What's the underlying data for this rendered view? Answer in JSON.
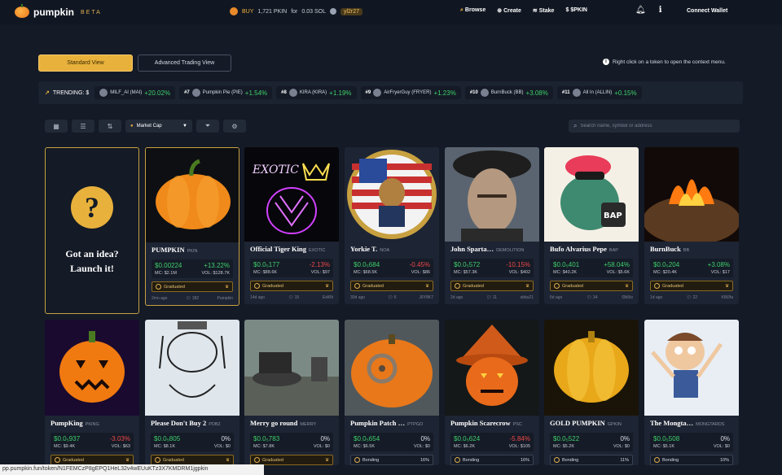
{
  "brand": {
    "name": "pumpkin",
    "tag": "BETA"
  },
  "ticker": {
    "action": "BUY",
    "amount": "1,721 PKIN",
    "for_label": "for",
    "sol": "0.03 SOL",
    "user": "yl2r27"
  },
  "nav": [
    {
      "icon": "search-icon",
      "glyph": "⌕",
      "label": "Browse"
    },
    {
      "icon": "plus-circle-icon",
      "glyph": "⊕",
      "label": "Create"
    },
    {
      "icon": "stack-icon",
      "glyph": "≋",
      "label": "Stake"
    },
    {
      "icon": "dollar-icon",
      "glyph": "$",
      "label": "$PKIN"
    }
  ],
  "connect_label": "Connect Wallet",
  "views": {
    "standard": "Standard View",
    "advanced": "Advanced Trading View"
  },
  "hint": "Right click on a token to open the context menu.",
  "trending": {
    "label": "TRENDING:",
    "prefix": "$",
    "items": [
      {
        "rank": "",
        "name": "MILF_AI (MAI)",
        "pct": "+20.02%"
      },
      {
        "rank": "#7",
        "name": "Pumpkin Pie (PIE)",
        "pct": "+1.54%"
      },
      {
        "rank": "#8",
        "name": "KIRA (KIRA)",
        "pct": "+1.19%"
      },
      {
        "rank": "#9",
        "name": "AirFryerGuy (FRYER)",
        "pct": "+1.23%"
      },
      {
        "rank": "#10",
        "name": "BurnBuck (BB)",
        "pct": "+3.08%"
      },
      {
        "rank": "#11",
        "name": "All In (ALLIN)",
        "pct": "+0.15%"
      }
    ]
  },
  "toolbar": {
    "sort": "Market Cap",
    "search_placeholder": "Search name, symbol or address"
  },
  "idea": {
    "line1": "Got an idea?",
    "line2": "Launch it!",
    "glyph": "?"
  },
  "cards_row1": [
    {
      "name": "PUMPKIN",
      "sym": "PKIN",
      "price": "$0.00224",
      "pct": "+13.22%",
      "dir": "up",
      "mc": "MC: $2.1M",
      "vol": "VOL: $128.7K",
      "badge": "Graduated",
      "type": "grad",
      "age": "2mo ago",
      "replies": "182",
      "creator": "Pumpkin"
    },
    {
      "name": "Official Tiger King",
      "sym": "EXOTIC",
      "price": "$0.0₅177",
      "pct": "-2.13%",
      "dir": "dn",
      "mc": "MC: $88.6K",
      "vol": "VOL: $97",
      "badge": "Graduated",
      "type": "grad",
      "age": "14d ago",
      "replies": "15",
      "creator": "Ed45t"
    },
    {
      "name": "Yorkie T.",
      "sym": "NOA",
      "price": "$0.0₅684",
      "pct": "-0.45%",
      "dir": "dn",
      "mc": "MC: $68.5K",
      "vol": "VOL: $86",
      "badge": "Graduated",
      "type": "grad",
      "age": "30d ago",
      "replies": "6",
      "creator": "J6Y8K7"
    },
    {
      "name": "John Sparta…",
      "sym": "DEMOLITION",
      "price": "$0.0₅572",
      "pct": "-10.15%",
      "dir": "dn",
      "mc": "MC: $57.3K",
      "vol": "VOL: $402",
      "badge": "Graduated",
      "type": "grad",
      "age": "2d ago",
      "replies": "11",
      "creator": "sbbu21"
    },
    {
      "name": "Bufo Alvarius Pepe",
      "sym": "BAP",
      "price": "$0.0₅401",
      "pct": "+58.04%",
      "dir": "up",
      "mc": "MC: $40.2K",
      "vol": "VOL: $5.6K",
      "badge": "Graduated",
      "type": "grad",
      "age": "5d ago",
      "replies": "34",
      "creator": "f3b5tv"
    },
    {
      "name": "BurnBuck",
      "sym": "BB",
      "price": "$0.0₅204",
      "pct": "+3.08%",
      "dir": "up",
      "mc": "MC: $20.4K",
      "vol": "VOL: $17",
      "badge": "Graduated",
      "type": "grad",
      "age": "1d ago",
      "replies": "22",
      "creator": "K8t2fa"
    }
  ],
  "cards_row2": [
    {
      "name": "PumpKing",
      "sym": "PKING",
      "price": "$0.0₅937",
      "pct": "-3.03%",
      "dir": "dn",
      "mc": "MC: $9.4K",
      "vol": "VOL: $63",
      "badge": "Graduated",
      "type": "grad"
    },
    {
      "name": "Please Don't Buy 2",
      "sym": "PDB2",
      "price": "$0.0₅805",
      "pct": "0%",
      "dir": "flat",
      "mc": "MC: $8.1K",
      "vol": "VOL: $0",
      "badge": "Graduated",
      "type": "grad"
    },
    {
      "name": "Merry go round",
      "sym": "MERRY",
      "price": "$0.0₅783",
      "pct": "0%",
      "dir": "flat",
      "mc": "MC: $7.8K",
      "vol": "VOL: $0",
      "badge": "Graduated",
      "type": "grad"
    },
    {
      "name": "Pumpkin Patch …",
      "sym": "PTPGO",
      "price": "$0.0₅654",
      "pct": "0%",
      "dir": "flat",
      "mc": "MC: $6.5K",
      "vol": "VOL: $0",
      "badge": "Bonding",
      "bond": "16%",
      "type": "bond"
    },
    {
      "name": "Pumpkin Scarecrow",
      "sym": "PSC",
      "price": "$0.0₅624",
      "pct": "-5.84%",
      "dir": "dn",
      "mc": "MC: $6.2K",
      "vol": "VOL: $105",
      "badge": "Bonding",
      "bond": "16%",
      "type": "bond"
    },
    {
      "name": "GOLD PUMPKIN",
      "sym": "GPKIN",
      "price": "$0.0₅522",
      "pct": "0%",
      "dir": "flat",
      "mc": "MC: $5.2K",
      "vol": "VOL: $0",
      "badge": "Bonding",
      "bond": "11%",
      "type": "bond"
    },
    {
      "name": "The Mongta…",
      "sym": "MONGTARDS",
      "price": "$0.0₅508",
      "pct": "0%",
      "dir": "flat",
      "mc": "MC: $5.1K",
      "vol": "VOL: $0",
      "badge": "Bonding",
      "bond": "10%",
      "type": "bond"
    }
  ],
  "status_url": "pp.pumpkin.fun/token/N1FEMCzP8gEPQ1HeL32v4wEUuKTz3X7KMDRM1jgpkin"
}
